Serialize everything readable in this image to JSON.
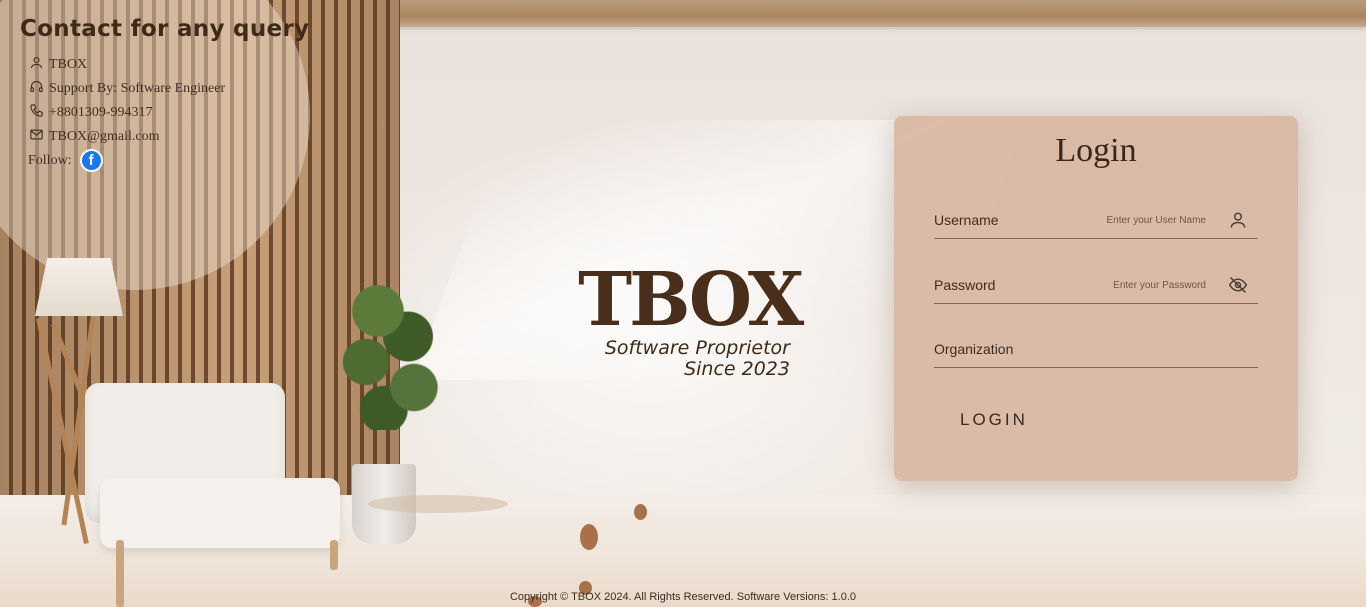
{
  "contact": {
    "title": "Contact for any query",
    "name": "TBOX",
    "support": "Support By: Software Engineer",
    "phone": "+8801309-994317",
    "email": "TBOX@gmail.com",
    "follow_label": "Follow:",
    "facebook_glyph": "f"
  },
  "logo": {
    "main": "TBOX",
    "subtitle": "Software Proprietor",
    "since": "Since 2023"
  },
  "login": {
    "title": "Login",
    "username_label": "Username",
    "username_placeholder": "Enter your User Name",
    "password_label": "Password",
    "password_placeholder": "Enter your Password",
    "organization_label": "Organization",
    "organization_value": "",
    "button_label": "LOGIN"
  },
  "footer": {
    "text": "Copyright © TBOX 2024. All Rights Reserved. Software Versions: 1.0.0"
  },
  "icons": {
    "user": "user-icon",
    "headset": "headset-icon",
    "phone": "phone-icon",
    "mail": "mail-icon",
    "facebook": "facebook-icon",
    "eye_off": "eye-off-icon"
  },
  "colors": {
    "card_bg": "#d7b7a3",
    "brand_dark": "#4a2e1c",
    "facebook": "#1877f2"
  }
}
